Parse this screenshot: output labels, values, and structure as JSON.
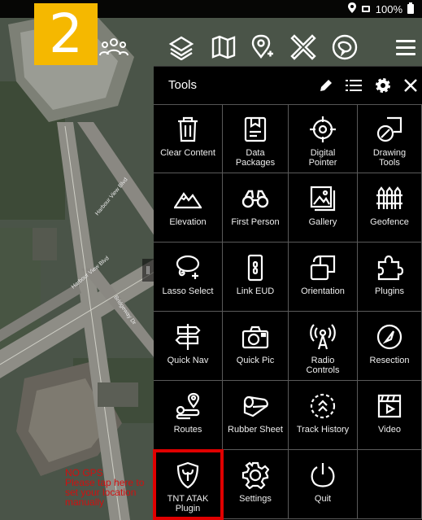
{
  "status_bar": {
    "battery": "100%",
    "icons": [
      "location-icon",
      "signal-icon",
      "battery-icon"
    ]
  },
  "step_badge": "2",
  "top_toolbar": {
    "icons": [
      "contacts-icon",
      "layers-icon",
      "map-icon",
      "add-marker-icon",
      "tools-cross-icon",
      "chat-icon",
      "menu-icon"
    ]
  },
  "tools_panel": {
    "title": "Tools",
    "header_icons": [
      "edit-icon",
      "list-icon",
      "settings-icon",
      "close-icon"
    ],
    "items": [
      {
        "label": "Clear Content",
        "icon": "trash-icon"
      },
      {
        "label": "Data\nPackages",
        "icon": "package-icon"
      },
      {
        "label": "Digital\nPointer",
        "icon": "crosshair-icon"
      },
      {
        "label": "Drawing\nTools",
        "icon": "drawing-icon"
      },
      {
        "label": "Elevation",
        "icon": "mountain-icon"
      },
      {
        "label": "First Person",
        "icon": "binoculars-icon"
      },
      {
        "label": "Gallery",
        "icon": "gallery-icon"
      },
      {
        "label": "Geofence",
        "icon": "fence-icon"
      },
      {
        "label": "Lasso Select",
        "icon": "lasso-icon"
      },
      {
        "label": "Link EUD",
        "icon": "phone-icon"
      },
      {
        "label": "Orientation",
        "icon": "orientation-icon"
      },
      {
        "label": "Plugins",
        "icon": "puzzle-icon"
      },
      {
        "label": "Quick Nav",
        "icon": "signpost-icon"
      },
      {
        "label": "Quick Pic",
        "icon": "camera-icon"
      },
      {
        "label": "Radio\nControls",
        "icon": "radio-icon"
      },
      {
        "label": "Resection",
        "icon": "compass-icon"
      },
      {
        "label": "Routes",
        "icon": "route-icon"
      },
      {
        "label": "Rubber Sheet",
        "icon": "rubber-sheet-icon"
      },
      {
        "label": "Track History",
        "icon": "track-history-icon"
      },
      {
        "label": "Video",
        "icon": "video-icon"
      },
      {
        "label": "TNT ATAK\nPlugin",
        "icon": "tnt-shield-icon"
      },
      {
        "label": "Settings",
        "icon": "gear-icon"
      },
      {
        "label": "Quit",
        "icon": "power-icon"
      },
      {
        "label": "",
        "icon": ""
      }
    ]
  },
  "gps_warning": "NO GPS\nPlease tap here to\nset your location\nmanually",
  "colors": {
    "badge": "#f5b800",
    "highlight": "#e00000",
    "warning": "#d01010",
    "panel_bg": "#000000"
  }
}
